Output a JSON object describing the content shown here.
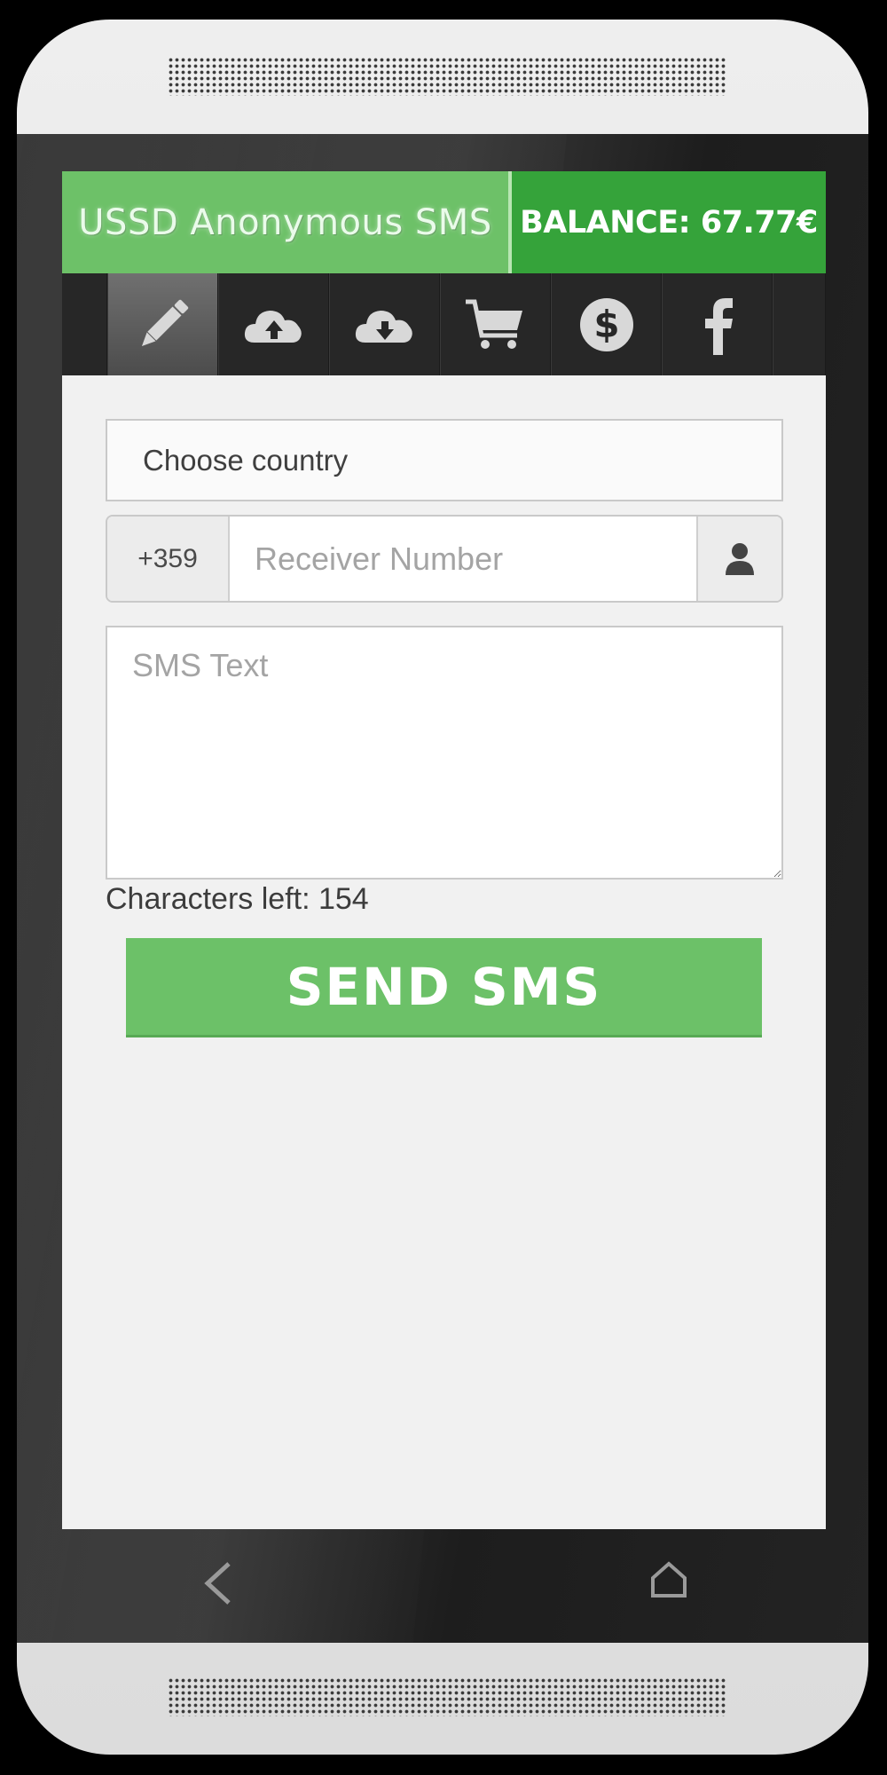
{
  "app": {
    "title": "USSD Anonymous SMS",
    "balance": "BALANCE: 67.77€"
  },
  "toolbar": {
    "tabs": [
      {
        "icon": "pencil-icon",
        "active": true
      },
      {
        "icon": "cloud-upload-icon",
        "active": false
      },
      {
        "icon": "cloud-download-icon",
        "active": false
      },
      {
        "icon": "shopping-cart-icon",
        "active": false
      },
      {
        "icon": "dollar-icon",
        "active": false
      },
      {
        "icon": "facebook-icon",
        "active": false
      }
    ]
  },
  "form": {
    "country_placeholder": "Choose country",
    "prefix": "+359",
    "receiver_placeholder": "Receiver Number",
    "sms_placeholder": "SMS Text",
    "characters_left": "Characters left: 154",
    "send_label": "SEND SMS"
  },
  "colors": {
    "title_green": "#6dc168",
    "balance_green": "#35a33a",
    "send_green": "#6cc168",
    "toolbar_dark": "#272727"
  }
}
